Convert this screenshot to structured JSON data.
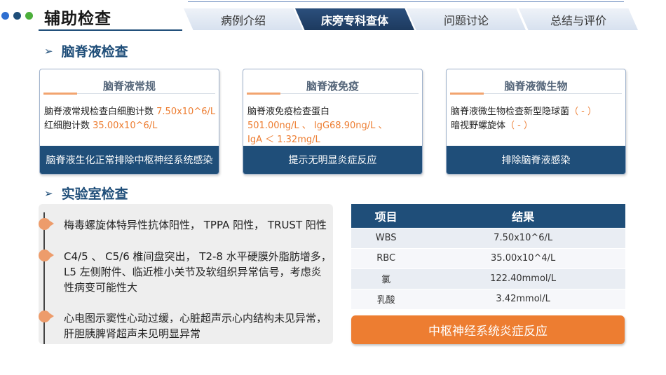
{
  "header": {
    "title": "辅助检查",
    "dot_colors": [
      "#2e6fd1",
      "#1f4e79",
      "#4caf3b"
    ],
    "tabs": [
      {
        "label": "病例介绍",
        "active": false
      },
      {
        "label": "床旁专科查体",
        "active": true
      },
      {
        "label": "问题讨论",
        "active": false
      },
      {
        "label": "总结与评价",
        "active": false
      }
    ]
  },
  "csf_section": {
    "heading": "脑脊液检查",
    "cards": [
      {
        "title": "脑脊液常规",
        "lines": [
          [
            {
              "t": "脑脊液常规检查白细胞计数 "
            },
            {
              "t": "7.50x10^6/L",
              "hl": true
            }
          ],
          [
            {
              "t": "红细胞计数 "
            },
            {
              "t": "35.00x10^6/L",
              "hl": true
            }
          ]
        ],
        "footer": "脑脊液生化正常排除中枢神经系统感染"
      },
      {
        "title": "脑脊液免疫",
        "lines": [
          [
            {
              "t": "脑脊液免疫检查蛋白"
            }
          ],
          [
            {
              "t": "501.00ng/L 、 IgG68.90ng/L 、",
              "hl": true
            }
          ],
          [
            {
              "t": "IgA ＜ 1.32mg/L",
              "hl": true
            }
          ]
        ],
        "footer": "提示无明显炎症反应"
      },
      {
        "title": "脑脊液微生物",
        "lines": [
          [
            {
              "t": "脑脊液微生物检查新型隐球菌"
            },
            {
              "t": "（ - ）",
              "hl": true
            }
          ],
          [
            {
              "t": "暗视野螺旋体"
            },
            {
              "t": "（ - ）",
              "hl": true
            }
          ]
        ],
        "footer": "排除脑脊液感染"
      }
    ]
  },
  "lab_section": {
    "heading": "实验室检查",
    "items": [
      "梅毒螺旋体特异性抗体阳性， TPPA 阳性， TRUST 阳性",
      "C4/5 、 C5/6 椎间盘突出， T2-8 水平硬膜外脂肪增多，L5 左侧附件、临近椎小关节及软组织异常信号，考虑炎性病变可能性大",
      "心电图示窦性心动过缓，心脏超声示心内结构未见异常，肝胆胰脾肾超声未见明显异常"
    ]
  },
  "lab_table": {
    "headers": [
      "项目",
      "结果"
    ],
    "rows": [
      [
        "WBS",
        "7.50x10^6/L"
      ],
      [
        "RBC",
        "35.00x10^4/L"
      ],
      [
        "氯",
        "122.40mmol/L"
      ],
      [
        "乳酸",
        "3.42mmol/L"
      ]
    ]
  },
  "conclusion_button": "中枢神经系统炎症反应"
}
